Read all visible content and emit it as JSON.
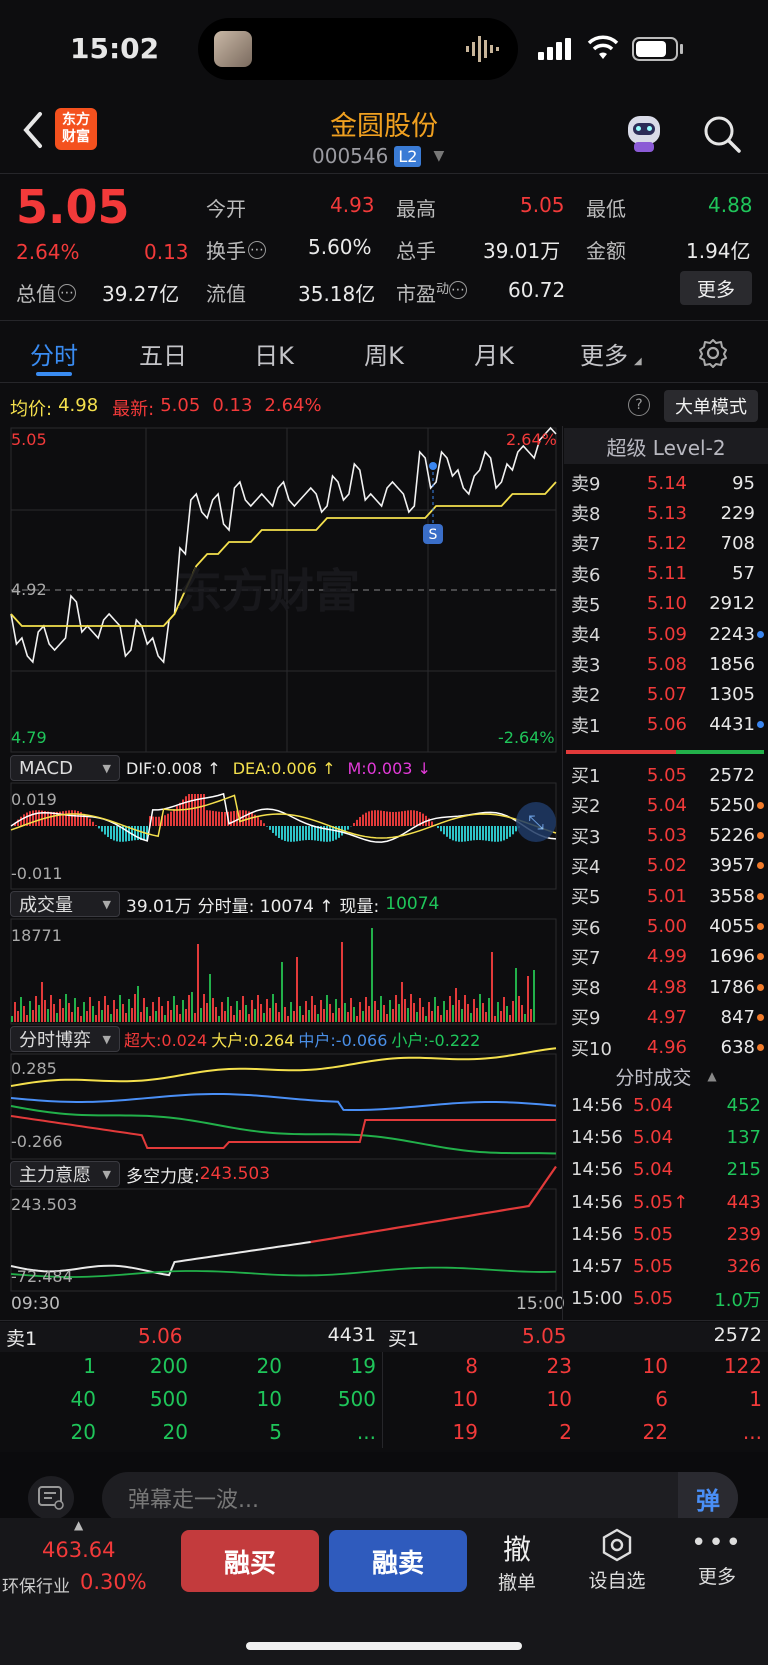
{
  "status_bar": {
    "time": "15:02"
  },
  "header": {
    "logo_text": "东方\n财富",
    "title": "金圆股份",
    "code": "000546",
    "level_badge": "L2"
  },
  "quote": {
    "price": "5.05",
    "pct": "2.64%",
    "change": "0.13",
    "open_label": "今开",
    "open": "4.93",
    "high_label": "最高",
    "high": "5.05",
    "low_label": "最低",
    "low": "4.88",
    "turnover_label": "换手",
    "turnover": "5.60%",
    "volume_label": "总手",
    "volume": "39.01万",
    "amount_label": "金额",
    "amount": "1.94亿",
    "mktcap_label": "总值",
    "mktcap": "39.27亿",
    "float_label": "流值",
    "float": "35.18亿",
    "pe_label": "市盈",
    "pe_sup": "动",
    "pe": "60.72",
    "more_button": "更多"
  },
  "tabs": [
    {
      "label": "分时",
      "active": true
    },
    {
      "label": "五日"
    },
    {
      "label": "日K"
    },
    {
      "label": "周K"
    },
    {
      "label": "月K"
    },
    {
      "label": "更多"
    }
  ],
  "intraday": {
    "avg_label": "均价:",
    "avg": "4.98",
    "last_label": "最新:",
    "last": "5.05",
    "chg": "0.13",
    "pct": "2.64%",
    "big_order_button": "大单模式",
    "y_top": "5.05",
    "y_mid": "4.92",
    "y_bottom": "4.79",
    "pct_top": "2.64%",
    "pct_bottom": "-2.64%",
    "marker": "S",
    "watermark": "东方财富",
    "price_series": [
      4.9,
      4.88,
      4.86,
      4.89,
      4.87,
      4.88,
      4.91,
      4.89,
      4.88,
      4.9,
      4.89,
      4.87,
      4.89,
      4.88,
      4.86,
      4.9,
      4.95,
      5.0,
      4.98,
      5.0,
      4.97,
      5.01,
      4.99,
      5.0,
      4.99,
      5.01,
      4.99,
      5.0,
      5.0,
      4.99,
      5.01,
      5.0,
      5.02,
      5.0,
      4.99,
      5.01,
      5.0,
      4.99,
      5.03,
      5.01,
      5.03,
      5.02,
      5.0,
      5.02,
      5.03,
      5.01,
      5.02,
      5.04,
      5.03,
      5.05,
      5.05
    ],
    "avg_series": [
      4.9,
      4.89,
      4.89,
      4.89,
      4.89,
      4.89,
      4.89,
      4.89,
      4.89,
      4.89,
      4.89,
      4.89,
      4.89,
      4.89,
      4.89,
      4.9,
      4.92,
      4.94,
      4.95,
      4.95,
      4.96,
      4.96,
      4.96,
      4.97,
      4.97,
      4.97,
      4.97,
      4.97,
      4.97,
      4.98,
      4.98,
      4.98,
      4.98,
      4.98,
      4.98,
      4.98,
      4.98,
      4.98,
      4.98,
      4.99,
      4.99,
      4.99,
      4.99,
      4.99,
      4.99,
      4.99,
      5.0,
      5.0,
      5.0,
      5.0,
      5.01
    ]
  },
  "macd": {
    "selector": "MACD",
    "dif": "DIF:0.008 ↑",
    "dea": "DEA:0.006 ↑",
    "m": "M:0.003 ↓",
    "y_top": "0.019",
    "y_bottom": "-0.011"
  },
  "volume_panel": {
    "selector": "成交量",
    "total": "39.01万",
    "bar_label": "分时量: 10074 ↑",
    "now_label": "现量:",
    "now": "10074",
    "y_top": "18771"
  },
  "game_panel": {
    "selector": "分时博弈",
    "super_label": "超大:0.024",
    "big_label": "大户:0.264",
    "mid_label": "中户:-0.066",
    "small_label": "小户:-0.222",
    "y_top": "0.285",
    "y_bottom": "-0.266"
  },
  "will_panel": {
    "selector": "主力意愿",
    "label": "多空力度:",
    "value": "243.503",
    "y_top": "243.503",
    "y_bottom": "-72.484",
    "x_start": "09:30",
    "x_end": "15:00"
  },
  "orderbook": {
    "title": "超级 Level-2",
    "asks": [
      {
        "label": "卖9",
        "price": "5.14",
        "vol": "95",
        "dot": ""
      },
      {
        "label": "卖8",
        "price": "5.13",
        "vol": "229",
        "dot": ""
      },
      {
        "label": "卖7",
        "price": "5.12",
        "vol": "708",
        "dot": ""
      },
      {
        "label": "卖6",
        "price": "5.11",
        "vol": "57",
        "dot": ""
      },
      {
        "label": "卖5",
        "price": "5.10",
        "vol": "2912",
        "dot": ""
      },
      {
        "label": "卖4",
        "price": "5.09",
        "vol": "2243",
        "dot": "#3a86f0"
      },
      {
        "label": "卖3",
        "price": "5.08",
        "vol": "1856",
        "dot": ""
      },
      {
        "label": "卖2",
        "price": "5.07",
        "vol": "1305",
        "dot": ""
      },
      {
        "label": "卖1",
        "price": "5.06",
        "vol": "4431",
        "dot": "#3a86f0"
      }
    ],
    "bids": [
      {
        "label": "买1",
        "price": "5.05",
        "vol": "2572",
        "dot": ""
      },
      {
        "label": "买2",
        "price": "5.04",
        "vol": "5250",
        "dot": "#f07a2a"
      },
      {
        "label": "买3",
        "price": "5.03",
        "vol": "5226",
        "dot": "#f07a2a"
      },
      {
        "label": "买4",
        "price": "5.02",
        "vol": "3957",
        "dot": "#f07a2a"
      },
      {
        "label": "买5",
        "price": "5.01",
        "vol": "3558",
        "dot": "#f07a2a"
      },
      {
        "label": "买6",
        "price": "5.00",
        "vol": "4055",
        "dot": "#f07a2a"
      },
      {
        "label": "买7",
        "price": "4.99",
        "vol": "1696",
        "dot": "#f07a2a"
      },
      {
        "label": "买8",
        "price": "4.98",
        "vol": "1786",
        "dot": "#f07a2a"
      },
      {
        "label": "买9",
        "price": "4.97",
        "vol": "847",
        "dot": "#f07a2a"
      },
      {
        "label": "买10",
        "price": "4.96",
        "vol": "638",
        "dot": "#f07a2a"
      }
    ],
    "trades_title": "分时成交",
    "trades": [
      {
        "time": "14:56",
        "price": "5.04",
        "vol": "452",
        "color": "green"
      },
      {
        "time": "14:56",
        "price": "5.04",
        "vol": "137",
        "color": "green"
      },
      {
        "time": "14:56",
        "price": "5.04",
        "vol": "215",
        "color": "green"
      },
      {
        "time": "14:56",
        "price": "5.05↑",
        "vol": "443",
        "color": "red"
      },
      {
        "time": "14:56",
        "price": "5.05",
        "vol": "239",
        "color": "red"
      },
      {
        "time": "14:57",
        "price": "5.05",
        "vol": "326",
        "color": "red"
      },
      {
        "time": "15:00",
        "price": "5.05",
        "vol": "1.0万",
        "color": "green"
      }
    ]
  },
  "queue": {
    "sell_label": "卖1",
    "sell_price": "5.06",
    "sell_vol": "4431",
    "buy_label": "买1",
    "buy_price": "5.05",
    "buy_vol": "2572",
    "sell_rows": [
      [
        "1",
        "200",
        "20",
        "19"
      ],
      [
        "40",
        "500",
        "10",
        "500"
      ],
      [
        "20",
        "20",
        "5",
        "..."
      ]
    ],
    "buy_rows": [
      [
        "8",
        "23",
        "10",
        "122"
      ],
      [
        "10",
        "10",
        "6",
        "1"
      ],
      [
        "19",
        "2",
        "22",
        "..."
      ]
    ]
  },
  "danmaku": {
    "placeholder": "弹幕走一波...",
    "button": "弹"
  },
  "bottom": {
    "index_value": "463.64",
    "industry": "环保行业",
    "industry_pct": "0.30%",
    "buy_button": "融买",
    "sell_button": "融卖",
    "cancel_glyph": "撤",
    "cancel_label": "撤单",
    "watch_label": "设自选",
    "more_label": "更多"
  }
}
